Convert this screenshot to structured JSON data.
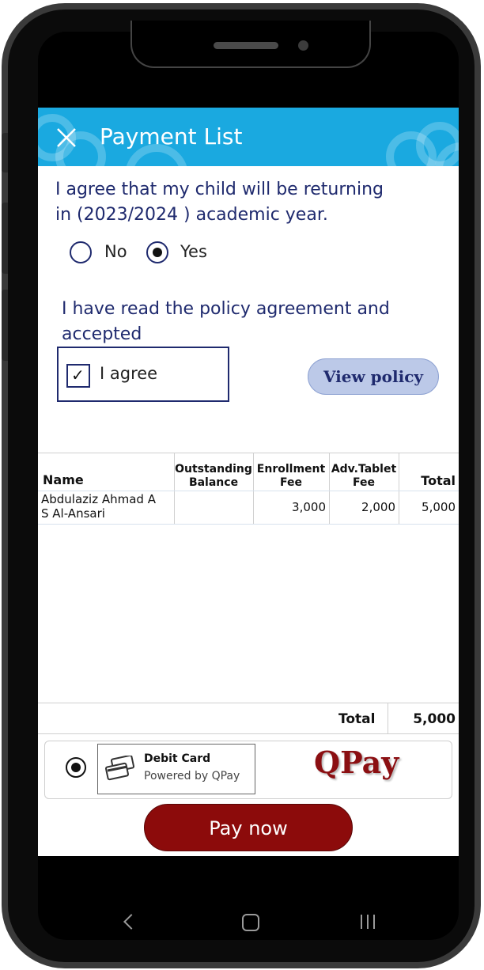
{
  "header": {
    "title": "Payment List"
  },
  "return_prompt": {
    "line1": "I agree that my child will be returning",
    "line2": "in (2023/2024 ) academic year."
  },
  "return_options": [
    {
      "label": "No",
      "selected": false
    },
    {
      "label": "Yes",
      "selected": true
    }
  ],
  "policy_prompt": {
    "line1": "I have read the policy agreement and",
    "line2": "accepted"
  },
  "agree_checkbox": {
    "label": "I agree",
    "checked": true,
    "mark": "✓"
  },
  "view_policy_label": "View policy",
  "table": {
    "headers": {
      "name": "Name",
      "outstanding_1": "Outstanding",
      "outstanding_2": "Balance",
      "enrollment_1": "Enrollment",
      "enrollment_2": "Fee",
      "tablet_1": "Adv.Tablet",
      "tablet_2": "Fee",
      "total": "Total"
    },
    "rows": [
      {
        "name_1": "Abdulaziz Ahmad A",
        "name_2": "S Al-Ansari",
        "outstanding": "",
        "enrollment": "3,000",
        "tablet": "2,000",
        "total": "5,000"
      }
    ]
  },
  "summary": {
    "total_label": "Total",
    "total_value": "5,000"
  },
  "payment_method": {
    "title": "Debit Card",
    "subtitle": "Powered by QPay",
    "logo_text": "QPay",
    "selected": true
  },
  "pay_button_label": "Pay now",
  "icons": [
    "close-icon",
    "credit-card-icon",
    "nav-back-icon",
    "nav-home-icon",
    "nav-recent-icon"
  ],
  "colors": {
    "header": "#1aa9e0",
    "text_primary": "#1f2a6e",
    "pay_button": "#8c0b0b",
    "policy_button": "#bcc9e8"
  }
}
